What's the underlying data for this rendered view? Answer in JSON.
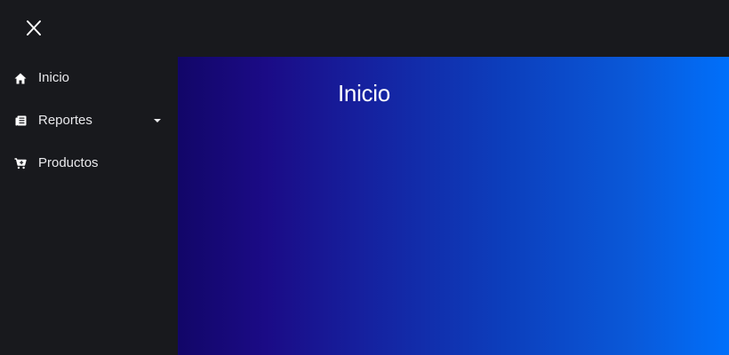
{
  "header": {
    "close_icon": "close-icon"
  },
  "sidebar": {
    "items": [
      {
        "label": "Inicio",
        "icon": "home-icon"
      },
      {
        "label": "Reportes",
        "icon": "newspaper-icon",
        "has_dropdown": true
      },
      {
        "label": "Productos",
        "icon": "cart-plus-icon"
      }
    ]
  },
  "main": {
    "title": "Inicio"
  },
  "colors": {
    "sidebar_bg": "#18191d",
    "text": "#e9e9ec",
    "gradient_start": "#120668",
    "gradient_end": "#0070fb"
  }
}
